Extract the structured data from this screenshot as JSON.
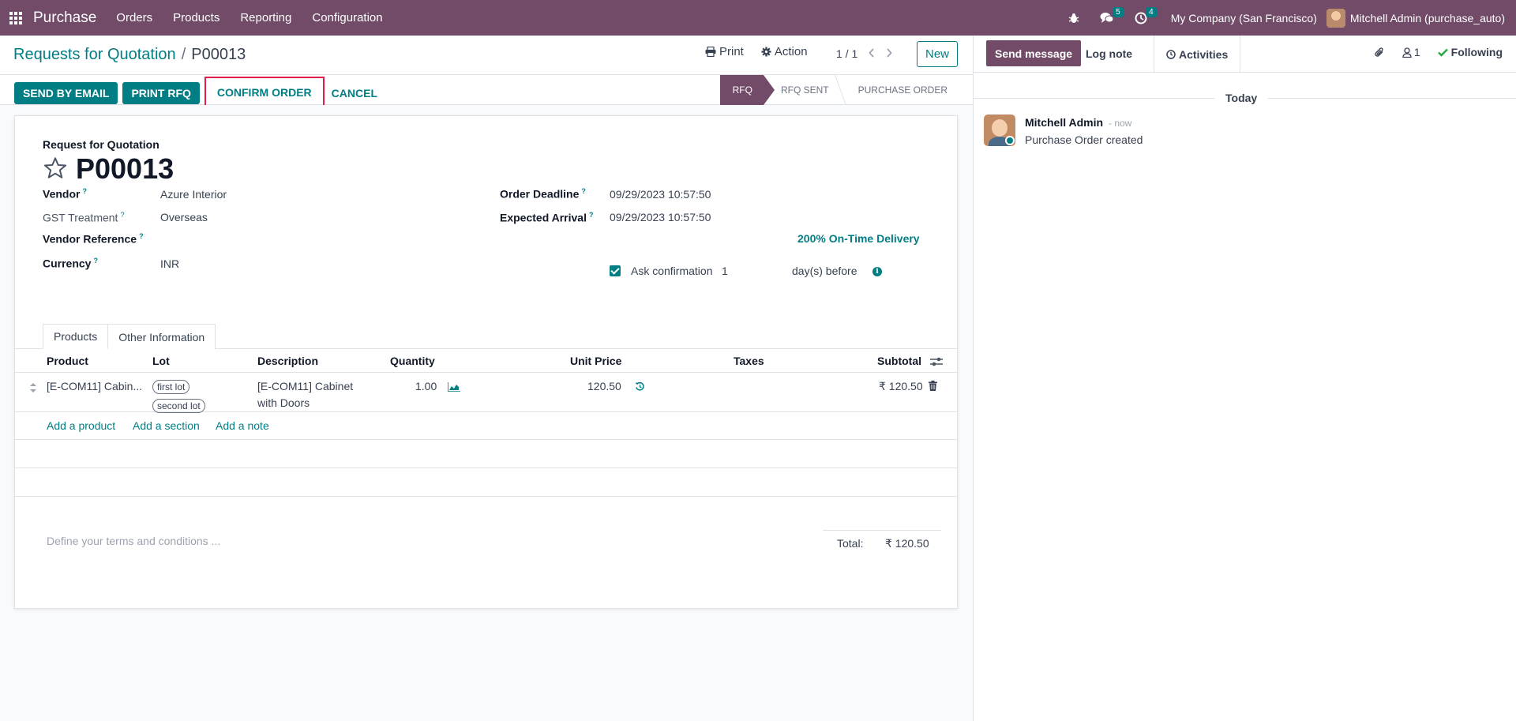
{
  "navbar": {
    "app_name": "Purchase",
    "menu": [
      "Orders",
      "Products",
      "Reporting",
      "Configuration"
    ],
    "messages_count": "5",
    "activities_count": "4",
    "company": "My Company (San Francisco)",
    "user": "Mitchell Admin (purchase_auto)"
  },
  "control": {
    "breadcrumb_parent": "Requests for Quotation",
    "breadcrumb_sep": "/",
    "breadcrumb_current": "P00013",
    "print_label": "Print",
    "action_label": "Action",
    "pager": "1 / 1",
    "new_label": "New"
  },
  "statusbar": {
    "send_email": "SEND BY EMAIL",
    "print_rfq": "PRINT RFQ",
    "confirm_order": "CONFIRM ORDER",
    "cancel": "CANCEL",
    "stages": [
      "RFQ",
      "RFQ SENT",
      "PURCHASE ORDER"
    ],
    "active_stage": "RFQ"
  },
  "form": {
    "doc_type": "Request for Quotation",
    "doc_name": "P00013",
    "vendor_label": "Vendor",
    "vendor": "Azure Interior",
    "gst_label": "GST Treatment",
    "gst": "Overseas",
    "vendor_ref_label": "Vendor Reference",
    "vendor_ref": "",
    "currency_label": "Currency",
    "currency": "INR",
    "deadline_label": "Order Deadline",
    "deadline": "09/29/2023 10:57:50",
    "arrival_label": "Expected Arrival",
    "arrival": "09/29/2023 10:57:50",
    "on_time": "200% On-Time Delivery",
    "ask_confirmation_label": "Ask confirmation",
    "ask_confirmation_days": "1",
    "days_before": "day(s) before",
    "help_mark": "?"
  },
  "tabs": [
    "Products",
    "Other Information"
  ],
  "table": {
    "headers": [
      "Product",
      "Lot",
      "Description",
      "Quantity",
      "Unit Price",
      "Taxes",
      "Subtotal"
    ],
    "rows": [
      {
        "product": "[E-COM11] Cabin...",
        "lots": [
          "first lot",
          "second lot"
        ],
        "description_line1": "[E-COM11] Cabinet",
        "description_line2": "with Doors",
        "quantity": "1.00",
        "unit_price": "120.50",
        "taxes": "",
        "subtotal": "₹ 120.50"
      }
    ],
    "add_product": "Add a product",
    "add_section": "Add a section",
    "add_note": "Add a note"
  },
  "footer": {
    "terms_placeholder": "Define your terms and conditions ...",
    "total_label": "Total:",
    "total_value": "₹ 120.50"
  },
  "chatter": {
    "send_message": "Send message",
    "log_note": "Log note",
    "activities": "Activities",
    "followers_count": "1",
    "following": "Following",
    "today": "Today",
    "message": {
      "author": "Mitchell Admin",
      "time": "- now",
      "body": "Purchase Order created"
    }
  },
  "colors": {
    "brand": "#714B67",
    "accent": "#017e84",
    "following": "#28a745",
    "highlight": "#e11d48"
  }
}
